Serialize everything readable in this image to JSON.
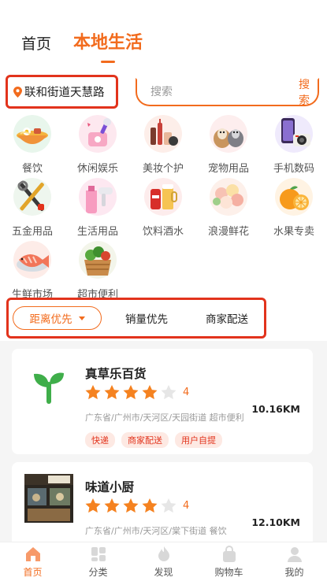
{
  "top_tabs": [
    {
      "label": "首页",
      "active": false
    },
    {
      "label": "本地生活",
      "active": true
    }
  ],
  "location": {
    "text": "联和街道天慧路",
    "icon": "location-pin-icon"
  },
  "search": {
    "placeholder": "搜索",
    "button_label": "搜索"
  },
  "categories": [
    {
      "label": "餐饮",
      "icon": "noodle-bowl-icon"
    },
    {
      "label": "休闲娱乐",
      "icon": "microphone-icon"
    },
    {
      "label": "美妆个护",
      "icon": "cosmetics-icon"
    },
    {
      "label": "宠物用品",
      "icon": "pets-icon"
    },
    {
      "label": "手机数码",
      "icon": "phone-camera-icon"
    },
    {
      "label": "五金用品",
      "icon": "tools-icon"
    },
    {
      "label": "生活用品",
      "icon": "detergent-hairdryer-icon"
    },
    {
      "label": "饮料酒水",
      "icon": "drinks-icon"
    },
    {
      "label": "浪漫鲜花",
      "icon": "flowers-icon"
    },
    {
      "label": "水果专卖",
      "icon": "orange-fruit-icon"
    },
    {
      "label": "生鲜市场",
      "icon": "fresh-fish-icon"
    },
    {
      "label": "超市便利",
      "icon": "vegetable-basket-icon"
    }
  ],
  "sort_bar": {
    "active": "距离优先",
    "options": [
      "销量优先",
      "商家配送"
    ]
  },
  "shops": [
    {
      "name": "真草乐百货",
      "rating": "4",
      "stars_filled": 4,
      "stars_total": 5,
      "address": "广东省/广州市/天河区/天园街道 超市便利",
      "distance": "10.16KM",
      "tags": [
        "快递",
        "商家配送",
        "用户自提"
      ],
      "thumb": "green-sprout-logo"
    },
    {
      "name": "味道小厨",
      "rating": "4",
      "stars_filled": 4,
      "stars_total": 5,
      "address": "广东省/广州市/天河区/棠下街道 餐饮",
      "distance": "12.10KM",
      "tags": [],
      "thumb": "restaurant-storefront-photo"
    }
  ],
  "bottom_nav": [
    {
      "label": "首页",
      "icon": "home-icon",
      "active": true
    },
    {
      "label": "分类",
      "icon": "category-grid-icon",
      "active": false
    },
    {
      "label": "发现",
      "icon": "flame-icon",
      "active": false
    },
    {
      "label": "购物车",
      "icon": "shopping-bag-icon",
      "active": false
    },
    {
      "label": "我的",
      "icon": "user-icon",
      "active": false
    }
  ],
  "colors": {
    "accent": "#f26b1d",
    "highlight_border": "#e2331c",
    "star": "#f58220",
    "star_empty": "#e6e6e6"
  }
}
